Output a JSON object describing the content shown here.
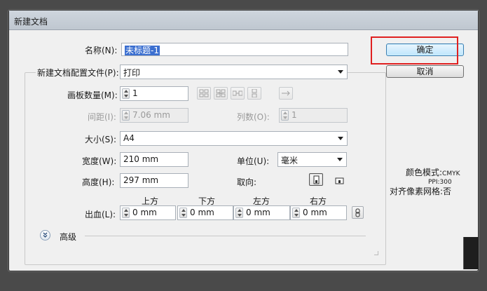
{
  "window": {
    "title": "新建文档"
  },
  "name_field": {
    "label": "名称(N):",
    "value": "未标题-1"
  },
  "buttons": {
    "ok": "确定",
    "cancel": "取消"
  },
  "profile": {
    "label": "新建文档配置文件(P):",
    "value": "打印"
  },
  "artboards": {
    "count_label": "画板数量(M):",
    "count_value": "1",
    "spacing_label": "间距(I):",
    "spacing_value": "7.06 mm",
    "columns_label": "列数(O):",
    "columns_value": "1"
  },
  "size": {
    "label": "大小(S):",
    "value": "A4"
  },
  "width": {
    "label": "宽度(W):",
    "value": "210 mm"
  },
  "height": {
    "label": "高度(H):",
    "value": "297 mm"
  },
  "units": {
    "label": "单位(U):",
    "value": "毫米"
  },
  "orientation": {
    "label": "取向:"
  },
  "bleed": {
    "label": "出血(L):",
    "top_label": "上方",
    "top_value": "0 mm",
    "bottom_label": "下方",
    "bottom_value": "0 mm",
    "left_label": "左方",
    "left_value": "0 mm",
    "right_label": "右方",
    "right_value": "0 mm"
  },
  "advanced": {
    "label": "高级"
  },
  "info": {
    "color_mode_label": "颜色模式:",
    "color_mode_value": "CMYK",
    "ppi_label": "PPI:",
    "ppi_value": "300",
    "align_label": "对齐像素网格:",
    "align_value": "否"
  },
  "colors": {
    "highlight": "#e02020",
    "selection": "#3b6fd0"
  }
}
